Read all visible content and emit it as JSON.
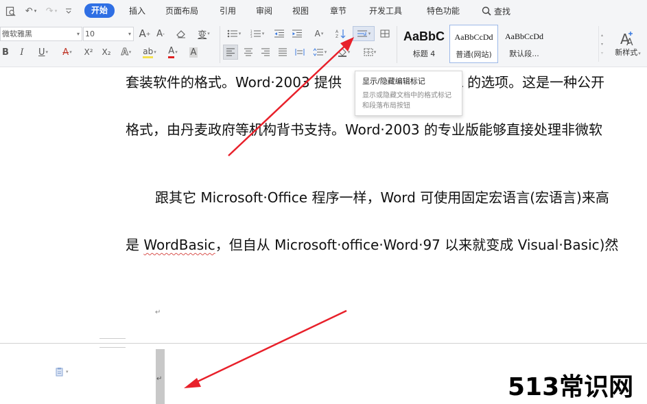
{
  "ribbon_tabs": [
    "开始",
    "插入",
    "页面布局",
    "引用",
    "审阅",
    "视图",
    "章节",
    "开发工具",
    "特色功能"
  ],
  "search_label": "查找",
  "font": {
    "name": "微软雅黑",
    "size": "10"
  },
  "format_buttons": {
    "bold": "B",
    "italic": "I",
    "underline": "U",
    "font_color_a": "A",
    "superscript": "X²",
    "subscript": "X₂",
    "text_effect": "A",
    "highlight": "ab",
    "font_color": "A",
    "char_shading": "A",
    "grow_font": "A",
    "shrink_font": "A",
    "phonetic": "变"
  },
  "styles": [
    {
      "sample": "AaBbC",
      "caption": "标题 4"
    },
    {
      "sample": "AaBbCcDd",
      "caption": "普通(网站)"
    },
    {
      "sample": "AaBbCcDd",
      "caption": "默认段..."
    }
  ],
  "new_style_label": "新样式",
  "tooltip": {
    "title": "显示/隐藏编辑标记",
    "body": "显示或隐藏文档中的格式标记和段落布局按钮"
  },
  "document": {
    "line1_a": "套装软件的格式。Word·2003 提供",
    "line1_b": "ngML 的选项。这是一种公开",
    "line2": "格式，由丹麦政府等机构背书支持。Word·2003 的专业版能够直接处理非微软",
    "line3": "跟其它 Microsoft·Office 程序一样，Word 可使用固定宏语言(宏语言)来高",
    "line4_a": "是 ",
    "line4_wordbasic": "WordBasic",
    "line4_b": "，但自从 Microsoft·office·Word·97 以来就变成 Visual·Basic)然",
    "paragraph_mark": "↵"
  },
  "watermark": "513常识网",
  "colors": {
    "accent": "#2f6fe4",
    "arrow": "#e8202a"
  }
}
